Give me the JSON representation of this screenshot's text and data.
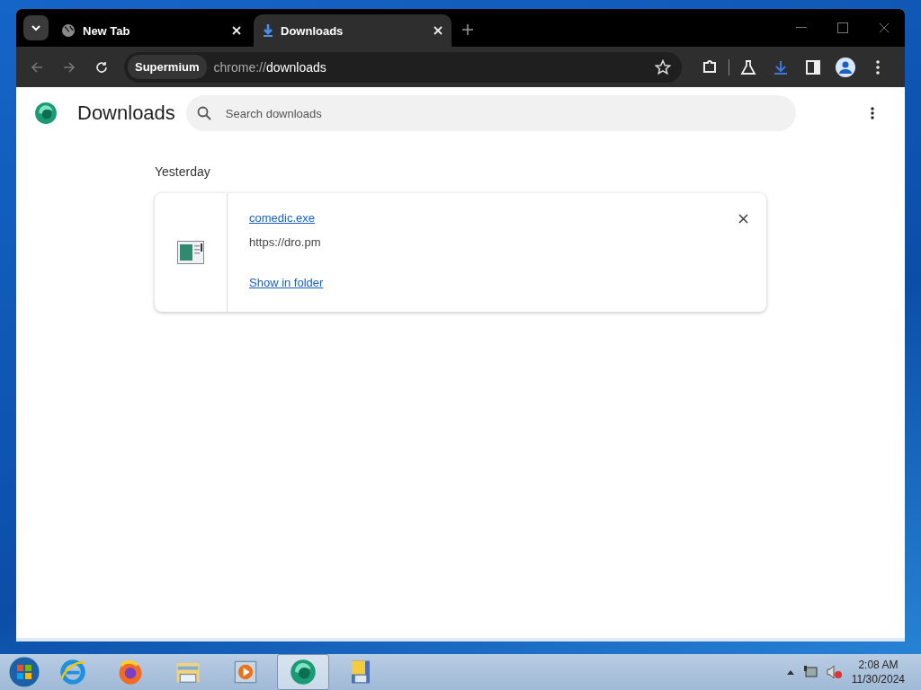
{
  "tabs": [
    {
      "title": "New Tab",
      "kind": "globe",
      "selected": false
    },
    {
      "title": "Downloads",
      "kind": "download",
      "selected": true
    }
  ],
  "toolbar": {
    "site_chip": "Supermium",
    "url": {
      "scheme": "chrome://",
      "path": "downloads"
    }
  },
  "page": {
    "title": "Downloads",
    "search": {
      "placeholder": "Search downloads"
    },
    "groups": [
      {
        "date": "Yesterday",
        "items": [
          {
            "file": "comedic.exe",
            "source": "https://dro.pm",
            "action": "Show in folder"
          }
        ]
      }
    ]
  },
  "taskbar": {
    "apps": [
      {
        "kind": "ie",
        "selected": false
      },
      {
        "kind": "firefox",
        "selected": false
      },
      {
        "kind": "explorer",
        "selected": false
      },
      {
        "kind": "media",
        "selected": false
      },
      {
        "kind": "browser",
        "selected": true
      },
      {
        "kind": "folder",
        "selected": false
      }
    ],
    "clock": {
      "time": "2:08 AM",
      "date": "11/30/2024"
    }
  }
}
